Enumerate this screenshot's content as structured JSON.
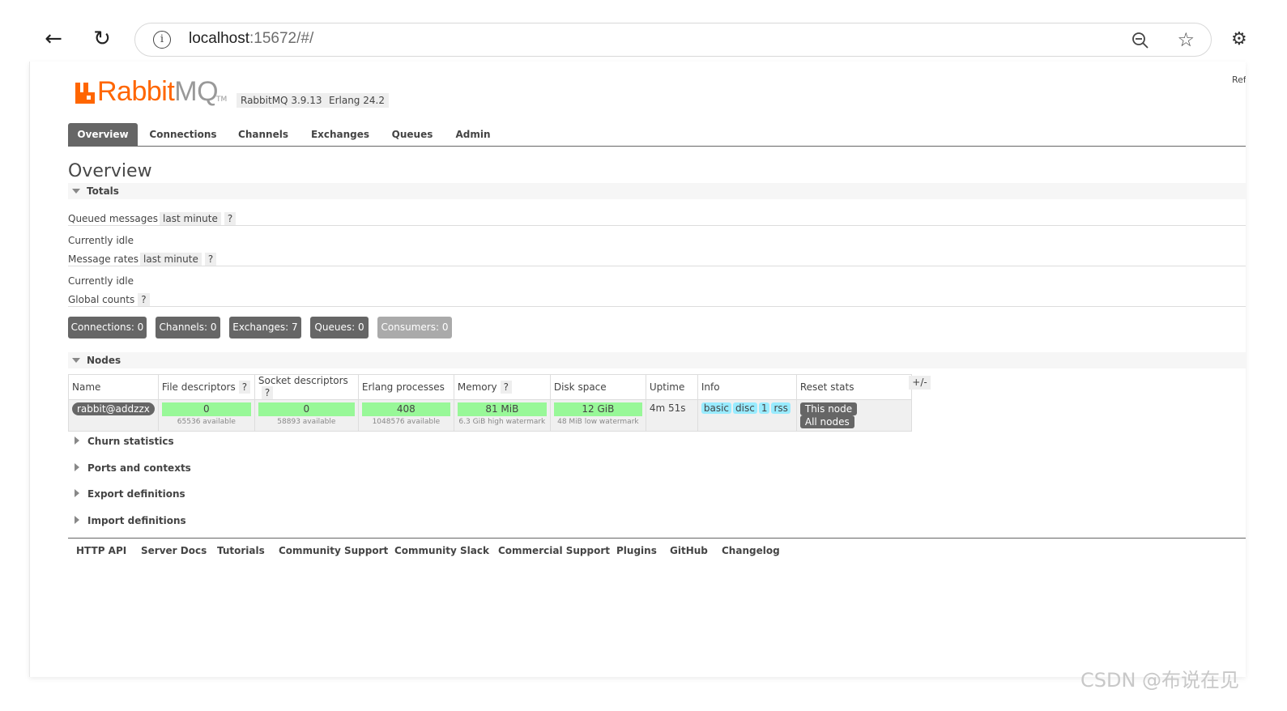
{
  "browser": {
    "url_host": "localhost",
    "url_rest": ":15672/#/",
    "back_icon": "←",
    "reload_icon": "↻",
    "info_icon": "i",
    "star_icon": "☆",
    "ext_icon": "⚙"
  },
  "header": {
    "logo_rabbit": "Rabbit",
    "logo_mq": "MQ",
    "logo_tm": "TM",
    "rabbitmq_version": "RabbitMQ 3.9.13",
    "erlang_version": "Erlang 24.2",
    "refresh_note": "Ref"
  },
  "tabs": [
    {
      "label": "Overview",
      "active": true
    },
    {
      "label": "Connections"
    },
    {
      "label": "Channels"
    },
    {
      "label": "Exchanges"
    },
    {
      "label": "Queues"
    },
    {
      "label": "Admin"
    }
  ],
  "page_title": "Overview",
  "totals": {
    "heading": "Totals",
    "queued_label": "Queued messages",
    "queued_range": "last minute",
    "help": "?",
    "queued_status": "Currently idle",
    "rates_label": "Message rates",
    "rates_range": "last minute",
    "rates_status": "Currently idle",
    "global_label": "Global counts",
    "counts": [
      {
        "label": "Connections: 0"
      },
      {
        "label": "Channels: 0"
      },
      {
        "label": "Exchanges: 7"
      },
      {
        "label": "Queues: 0"
      },
      {
        "label": "Consumers: 0",
        "disabled": true
      }
    ]
  },
  "nodes": {
    "heading": "Nodes",
    "columns": [
      "Name",
      "File descriptors",
      "Socket descriptors",
      "Erlang processes",
      "Memory",
      "Disk space",
      "Uptime",
      "Info",
      "Reset stats"
    ],
    "help": "?",
    "plusminus": "+/-",
    "row": {
      "name": "rabbit@addzzx",
      "file_desc": "0",
      "file_desc_sub": "65536 available",
      "socket_desc": "0",
      "socket_desc_sub": "58893 available",
      "erlang_proc": "408",
      "erlang_proc_sub": "1048576 available",
      "memory": "81 MiB",
      "memory_sub": "6.3 GiB high watermark",
      "disk": "12 GiB",
      "disk_sub": "48 MiB low watermark",
      "uptime": "4m 51s",
      "info_tags": [
        "basic",
        "disc",
        "1",
        "rss"
      ],
      "reset_this": "This node",
      "reset_all": "All nodes"
    }
  },
  "collapsed_sections": [
    "Churn statistics",
    "Ports and contexts",
    "Export definitions",
    "Import definitions"
  ],
  "footer_links": [
    "HTTP API",
    "Server Docs",
    "Tutorials",
    "Community Support",
    "Community Slack",
    "Commercial Support",
    "Plugins",
    "GitHub",
    "Changelog"
  ],
  "watermark": "CSDN @布说在见",
  "colors": {
    "brand": "#ff6600",
    "tab_active": "#666666",
    "bar_green": "#98f898",
    "tag_blue": "#99ebff"
  }
}
